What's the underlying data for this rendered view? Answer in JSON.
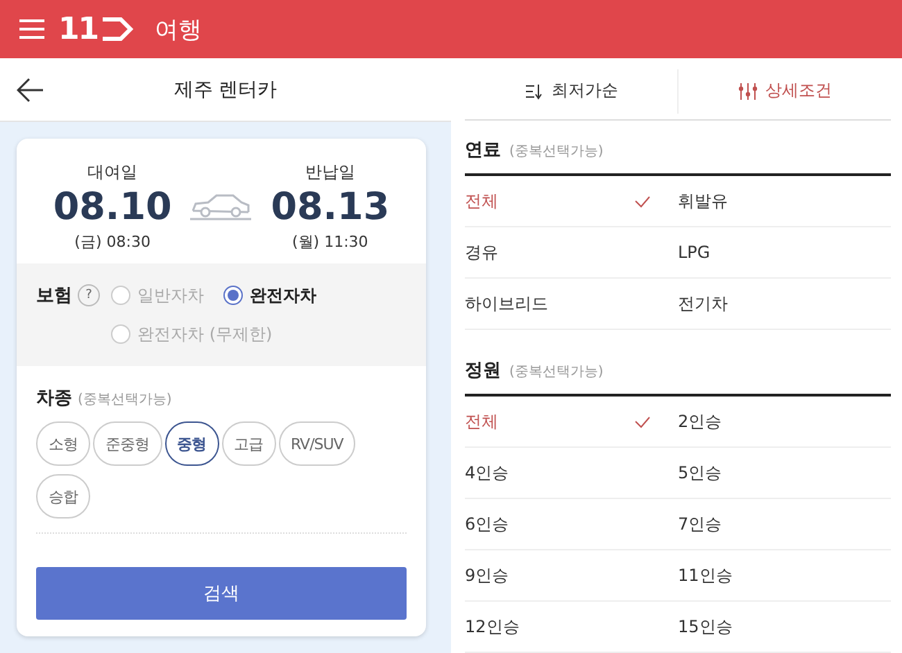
{
  "app_bar": {
    "logo": "11",
    "title": "여행"
  },
  "left": {
    "title": "제주 렌터카",
    "pickup": {
      "label": "대여일",
      "date": "08.10",
      "time": "(금) 08:30"
    },
    "return": {
      "label": "반납일",
      "date": "08.13",
      "time": "(월) 11:30"
    },
    "insurance": {
      "label": "보험",
      "help": "?",
      "options": [
        {
          "label": "일반자차",
          "selected": false
        },
        {
          "label": "완전자차",
          "selected": true
        },
        {
          "label": "완전자차 (무제한)",
          "selected": false
        }
      ]
    },
    "car_type": {
      "label": "차종",
      "hint": "(중복선택가능)",
      "chips": [
        {
          "label": "소형",
          "selected": false
        },
        {
          "label": "준중형",
          "selected": false
        },
        {
          "label": "중형",
          "selected": true
        },
        {
          "label": "고급",
          "selected": false
        },
        {
          "label": "RV/SUV",
          "selected": false
        },
        {
          "label": "승합",
          "selected": false
        }
      ]
    },
    "search_button": "검색"
  },
  "right": {
    "tabs": [
      {
        "label": "최저가순",
        "kind": "sort",
        "selected": false
      },
      {
        "label": "상세조건",
        "kind": "filter",
        "selected": true
      }
    ],
    "sections": [
      {
        "title": "연료",
        "hint": "(중복선택가능)",
        "options": [
          {
            "label": "전체",
            "selected": true
          },
          {
            "label": "휘발유",
            "selected": false
          },
          {
            "label": "경유",
            "selected": false
          },
          {
            "label": "LPG",
            "selected": false
          },
          {
            "label": "하이브리드",
            "selected": false
          },
          {
            "label": "전기차",
            "selected": false
          }
        ]
      },
      {
        "title": "정원",
        "hint": "(중복선택가능)",
        "options": [
          {
            "label": "전체",
            "selected": true
          },
          {
            "label": "2인승",
            "selected": false
          },
          {
            "label": "4인승",
            "selected": false
          },
          {
            "label": "5인승",
            "selected": false
          },
          {
            "label": "6인승",
            "selected": false
          },
          {
            "label": "7인승",
            "selected": false
          },
          {
            "label": "9인승",
            "selected": false
          },
          {
            "label": "11인승",
            "selected": false
          },
          {
            "label": "12인승",
            "selected": false
          },
          {
            "label": "15인승",
            "selected": false
          }
        ]
      }
    ]
  }
}
